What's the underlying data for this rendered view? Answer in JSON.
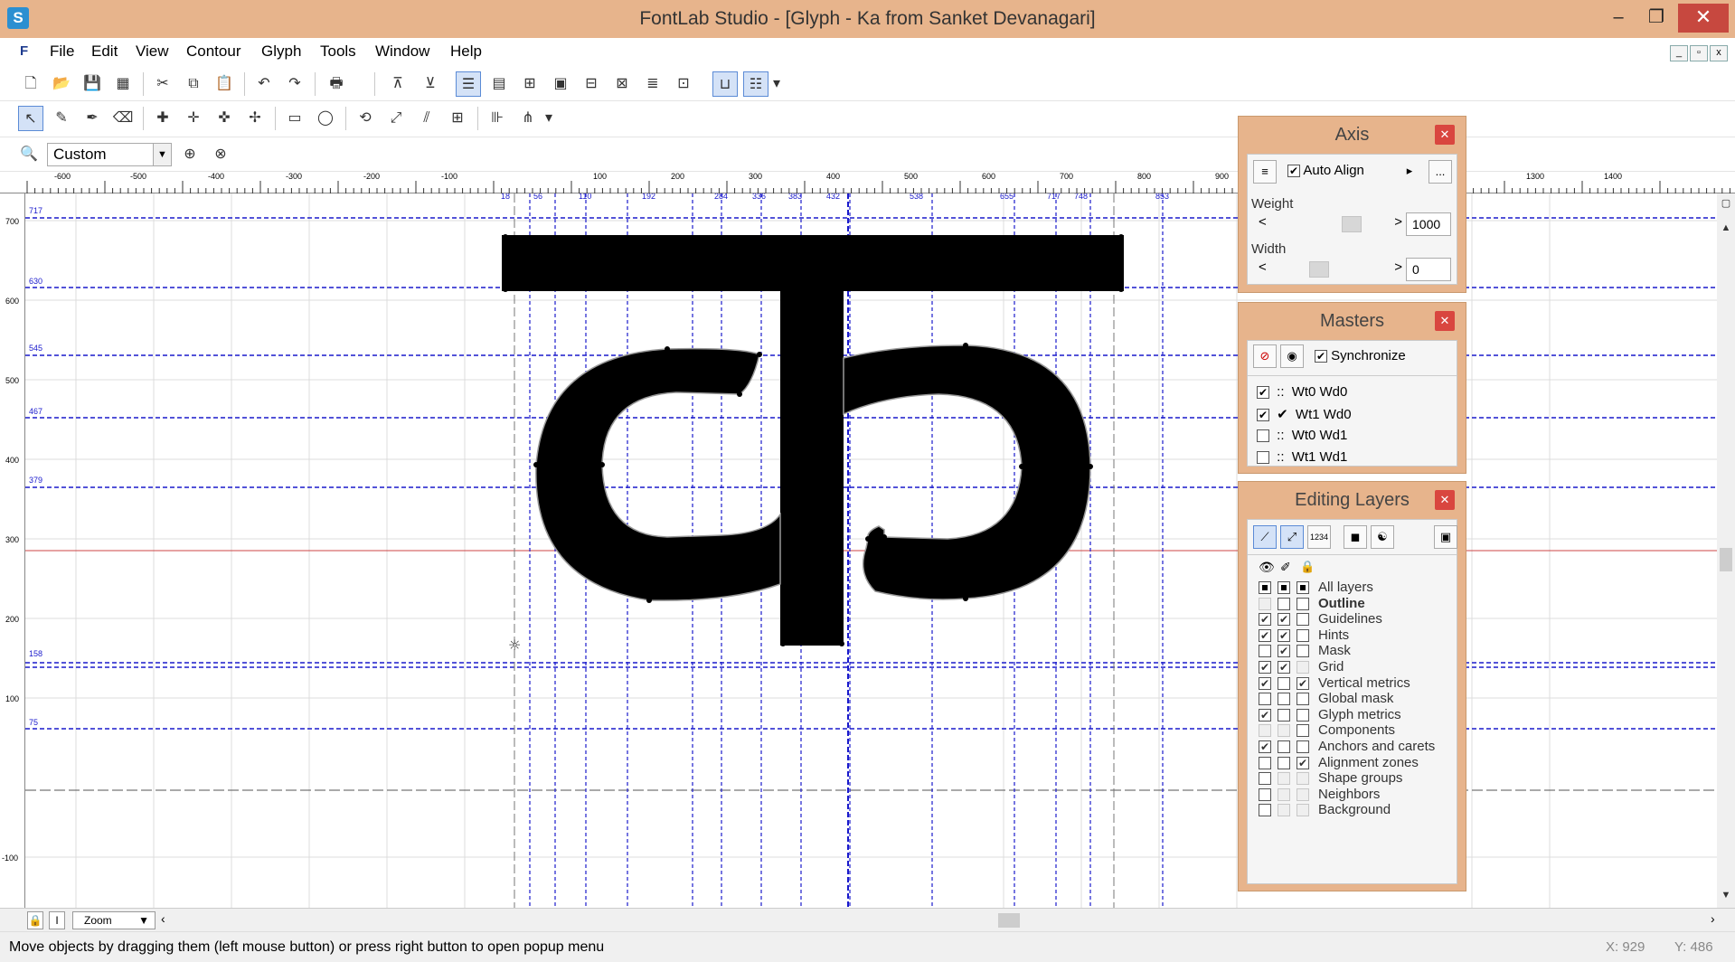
{
  "window": {
    "title": "FontLab Studio - [Glyph - Ka from Sanket Devanagari]",
    "minimize_glyph": "–",
    "maximize_glyph": "❐",
    "close_glyph": "✕"
  },
  "menu": [
    "File",
    "Edit",
    "View",
    "Contour",
    "Glyph",
    "Tools",
    "Window",
    "Help"
  ],
  "zoom_select": {
    "value": "Custom"
  },
  "ruler": {
    "h_labels": [
      "-600",
      "-500",
      "-400",
      "-300",
      "-200",
      "-100",
      "100",
      "200",
      "300",
      "400",
      "500",
      "600",
      "700",
      "800",
      "900",
      "1300",
      "1400"
    ],
    "v_labels": [
      "700",
      "600",
      "500",
      "400",
      "300",
      "200",
      "100",
      "-100"
    ]
  },
  "canvas": {
    "hint_labels_top": [
      "18",
      "56",
      "110",
      "192",
      "284",
      "336",
      "383",
      "432",
      "538",
      "655",
      "717",
      "748",
      "853"
    ],
    "zone_labels_left": [
      "717",
      "630",
      "545",
      "467",
      "379",
      "158",
      "75"
    ]
  },
  "bottom": {
    "zoom_label": "Zoom",
    "lock_icon": "lock",
    "text_tool_label": "I"
  },
  "status": {
    "message": "Move objects by dragging them (left mouse button) or press right button to open popup menu",
    "x": "X: 929",
    "y": "Y: 486"
  },
  "axis_panel": {
    "title": "Axis",
    "auto_align_label": "Auto Align",
    "auto_align_checked": true,
    "weight_label": "Weight",
    "weight_value": "1000",
    "width_label": "Width",
    "width_value": "0",
    "slider_left": "<",
    "slider_right": ">",
    "more_label": "..."
  },
  "masters_panel": {
    "title": "Masters",
    "synchronize_label": "Synchronize",
    "synchronize_checked": true,
    "masters": [
      {
        "label": "Wt0 Wd0",
        "checked": true,
        "mark": "::"
      },
      {
        "label": "Wt1 Wd0",
        "checked": true,
        "mark": "✔"
      },
      {
        "label": "Wt0 Wd1",
        "checked": false,
        "mark": "::"
      },
      {
        "label": "Wt1 Wd1",
        "checked": false,
        "mark": "::"
      }
    ]
  },
  "layers_panel": {
    "title": "Editing Layers",
    "layers": [
      {
        "name": "All layers",
        "c1": "filled",
        "c2": "filled",
        "c3": "filled",
        "bold": false
      },
      {
        "name": "Outline",
        "c1": "gray",
        "c2": "off",
        "c3": "off",
        "bold": true
      },
      {
        "name": "Guidelines",
        "c1": "on",
        "c2": "on",
        "c3": "off",
        "bold": false
      },
      {
        "name": "Hints",
        "c1": "on",
        "c2": "on",
        "c3": "off",
        "bold": false
      },
      {
        "name": "Mask",
        "c1": "off",
        "c2": "on",
        "c3": "off",
        "bold": false
      },
      {
        "name": "Grid",
        "c1": "on",
        "c2": "on",
        "c3": "gray",
        "bold": false
      },
      {
        "name": "Vertical metrics",
        "c1": "on",
        "c2": "off",
        "c3": "on",
        "bold": false
      },
      {
        "name": "Global mask",
        "c1": "off",
        "c2": "off",
        "c3": "off",
        "bold": false
      },
      {
        "name": "Glyph metrics",
        "c1": "on",
        "c2": "off",
        "c3": "off",
        "bold": false
      },
      {
        "name": "Components",
        "c1": "gray",
        "c2": "gray",
        "c3": "off",
        "bold": false
      },
      {
        "name": "Anchors and carets",
        "c1": "on",
        "c2": "off",
        "c3": "off",
        "bold": false
      },
      {
        "name": "Alignment zones",
        "c1": "off",
        "c2": "off",
        "c3": "on",
        "bold": false
      },
      {
        "name": "Shape groups",
        "c1": "off",
        "c2": "gray",
        "c3": "gray",
        "bold": false
      },
      {
        "name": "Neighbors",
        "c1": "off",
        "c2": "gray",
        "c3": "gray",
        "bold": false
      },
      {
        "name": "Background",
        "c1": "off",
        "c2": "gray",
        "c3": "gray",
        "bold": false
      }
    ]
  },
  "colors": {
    "title_bar": "#e7b48c",
    "panel_bg": "#e7b48c",
    "close_red": "#d9463f",
    "guideline_blue": "#1a1acc",
    "baseline_red": "#cc4444",
    "glyph_fill": "#000000"
  }
}
